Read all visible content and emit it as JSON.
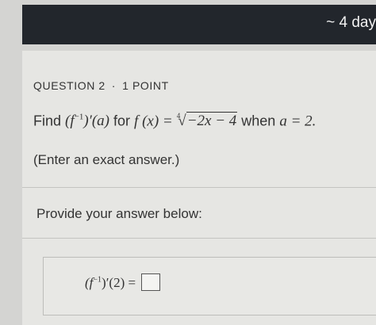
{
  "timer": {
    "text": "~ 4 day"
  },
  "question": {
    "header_label": "QUESTION 2",
    "separator": "·",
    "points": "1 POINT",
    "prompt_find": "Find",
    "expr_inverse": "(f",
    "expr_inverse_sup": "−1",
    "expr_inverse_close": ")′(a)",
    "prompt_for": "for",
    "expr_f": "f (x) =",
    "radical_index": "4",
    "radicand": "−2x − 4",
    "prompt_when": "when",
    "expr_a": "a = 2.",
    "note": "(Enter an exact answer.)"
  },
  "answer": {
    "provide_label": "Provide your answer below:",
    "expr_prefix": "(f",
    "expr_sup": "−1",
    "expr_suffix": ")′(2) ="
  }
}
